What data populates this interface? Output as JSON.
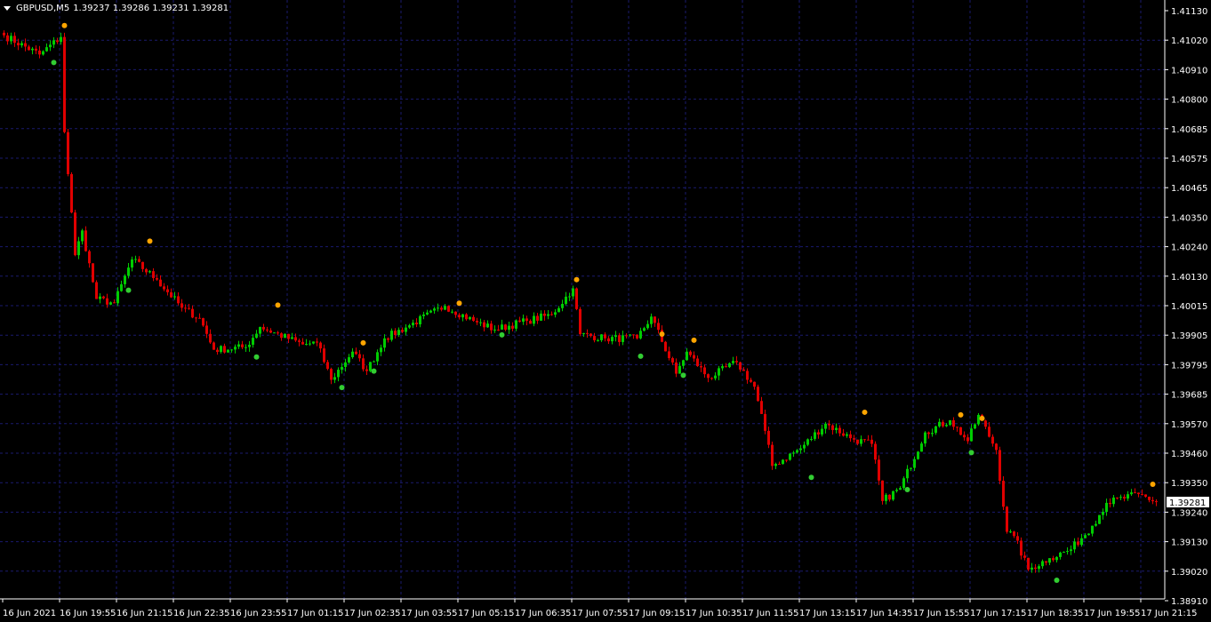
{
  "header": {
    "symbol": "GBPUSD,M5",
    "ohlc": "1.39237 1.39286 1.39231 1.39281",
    "menu_icon": "triangle-down-icon"
  },
  "colors": {
    "background": "#000000",
    "grid": "#1a1a6e",
    "bull": "#00cc00",
    "bear": "#e00000",
    "fractal_up": "#ffa500",
    "fractal_down": "#32cd32",
    "axis": "#ffffff"
  },
  "chart_data": {
    "type": "candlestick",
    "timeframe": "M5",
    "grid": true,
    "current_price": "1.39281",
    "y_ticks": [
      "1.41130",
      "1.41020",
      "1.40910",
      "1.40800",
      "1.40685",
      "1.40575",
      "1.40465",
      "1.40350",
      "1.40240",
      "1.40130",
      "1.40015",
      "1.39905",
      "1.39795",
      "1.39685",
      "1.39570",
      "1.39460",
      "1.39350",
      "1.39240",
      "1.39130",
      "1.39020",
      "1.38910"
    ],
    "x_ticks": [
      "16 Jun 2021",
      "16 Jun 19:55",
      "16 Jun 21:15",
      "16 Jun 22:35",
      "16 Jun 23:55",
      "17 Jun 01:15",
      "17 Jun 02:35",
      "17 Jun 03:55",
      "17 Jun 05:15",
      "17 Jun 06:35",
      "17 Jun 07:55",
      "17 Jun 09:15",
      "17 Jun 10:35",
      "17 Jun 11:55",
      "17 Jun 13:15",
      "17 Jun 14:35",
      "17 Jun 15:55",
      "17 Jun 17:15",
      "17 Jun 18:35",
      "17 Jun 19:55",
      "17 Jun 21:15"
    ],
    "close_path": [
      [
        "16 Jun 18:35",
        1.41037
      ],
      [
        "16 Jun 19:25",
        1.40965
      ],
      [
        "16 Jun 19:55",
        1.41031
      ],
      [
        "16 Jun 20:00",
        1.40673
      ],
      [
        "16 Jun 20:15",
        1.4021
      ],
      [
        "16 Jun 20:25",
        1.40303
      ],
      [
        "16 Jun 20:45",
        1.40045
      ],
      [
        "16 Jun 21:10",
        1.40029
      ],
      [
        "16 Jun 21:35",
        1.40194
      ],
      [
        "16 Jun 22:10",
        1.40118
      ],
      [
        "16 Jun 22:45",
        1.40012
      ],
      [
        "16 Jun 23:10",
        1.39973
      ],
      [
        "16 Jun 23:30",
        1.39854
      ],
      [
        "17 Jun 00:15",
        1.39864
      ],
      [
        "17 Jun 00:35",
        1.3994
      ],
      [
        "17 Jun 01:35",
        1.39874
      ],
      [
        "17 Jun 01:55",
        1.39881
      ],
      [
        "17 Jun 02:15",
        1.39741
      ],
      [
        "17 Jun 02:45",
        1.39847
      ],
      [
        "17 Jun 03:05",
        1.39774
      ],
      [
        "17 Jun 03:30",
        1.39897
      ],
      [
        "17 Jun 04:05",
        1.39946
      ],
      [
        "17 Jun 04:55",
        1.40019
      ],
      [
        "17 Jun 05:35",
        1.39963
      ],
      [
        "17 Jun 06:05",
        1.3993
      ],
      [
        "17 Jun 06:50",
        1.39963
      ],
      [
        "17 Jun 07:25",
        1.39986
      ],
      [
        "17 Jun 07:55",
        1.40085
      ],
      [
        "17 Jun 08:05",
        1.39913
      ],
      [
        "17 Jun 08:40",
        1.39897
      ],
      [
        "17 Jun 09:25",
        1.39897
      ],
      [
        "17 Jun 09:45",
        1.39979
      ],
      [
        "17 Jun 10:20",
        1.39764
      ],
      [
        "17 Jun 10:35",
        1.39847
      ],
      [
        "17 Jun 11:05",
        1.39748
      ],
      [
        "17 Jun 11:45",
        1.39807
      ],
      [
        "17 Jun 12:10",
        1.39715
      ],
      [
        "17 Jun 12:25",
        1.39549
      ],
      [
        "17 Jun 12:35",
        1.39417
      ],
      [
        "17 Jun 13:15",
        1.39483
      ],
      [
        "17 Jun 13:50",
        1.39576
      ],
      [
        "17 Jun 14:30",
        1.39516
      ],
      [
        "17 Jun 14:55",
        1.395
      ],
      [
        "17 Jun 15:10",
        1.39285
      ],
      [
        "17 Jun 15:35",
        1.39334
      ],
      [
        "17 Jun 16:10",
        1.39543
      ],
      [
        "17 Jun 16:45",
        1.39589
      ],
      [
        "17 Jun 17:10",
        1.3951
      ],
      [
        "17 Jun 17:25",
        1.39609
      ],
      [
        "17 Jun 17:50",
        1.39477
      ],
      [
        "17 Jun 18:05",
        1.39169
      ],
      [
        "17 Jun 18:15",
        1.39153
      ],
      [
        "17 Jun 18:35",
        1.39027
      ],
      [
        "17 Jun 19:05",
        1.3907
      ],
      [
        "17 Jun 19:35",
        1.39103
      ],
      [
        "17 Jun 20:05",
        1.39192
      ],
      [
        "17 Jun 20:25",
        1.39278
      ],
      [
        "17 Jun 21:10",
        1.39311
      ],
      [
        "17 Jun 21:35",
        1.39281
      ]
    ],
    "fractals_up": [
      [
        "16 Jun 20:00",
        1.41074
      ],
      [
        "16 Jun 22:00",
        1.40263
      ],
      [
        "17 Jun 01:00",
        1.40022
      ],
      [
        "17 Jun 03:00",
        1.3988
      ],
      [
        "17 Jun 05:15",
        1.40029
      ],
      [
        "17 Jun 08:00",
        1.40118
      ],
      [
        "17 Jun 10:00",
        1.39913
      ],
      [
        "17 Jun 10:45",
        1.3989
      ],
      [
        "17 Jun 14:45",
        1.39619
      ],
      [
        "17 Jun 17:00",
        1.39609
      ],
      [
        "17 Jun 17:30",
        1.39596
      ],
      [
        "17 Jun 21:30",
        1.39348
      ]
    ],
    "fractals_down": [
      [
        "16 Jun 19:45",
        1.40935
      ],
      [
        "16 Jun 21:30",
        1.40078
      ],
      [
        "17 Jun 00:30",
        1.39827
      ],
      [
        "17 Jun 02:30",
        1.39712
      ],
      [
        "17 Jun 03:15",
        1.39774
      ],
      [
        "17 Jun 06:15",
        1.3991
      ],
      [
        "17 Jun 09:30",
        1.3983
      ],
      [
        "17 Jun 10:30",
        1.39758
      ],
      [
        "17 Jun 13:30",
        1.39374
      ],
      [
        "17 Jun 15:45",
        1.39328
      ],
      [
        "17 Jun 17:15",
        1.39467
      ],
      [
        "17 Jun 19:15",
        1.38987
      ]
    ]
  }
}
